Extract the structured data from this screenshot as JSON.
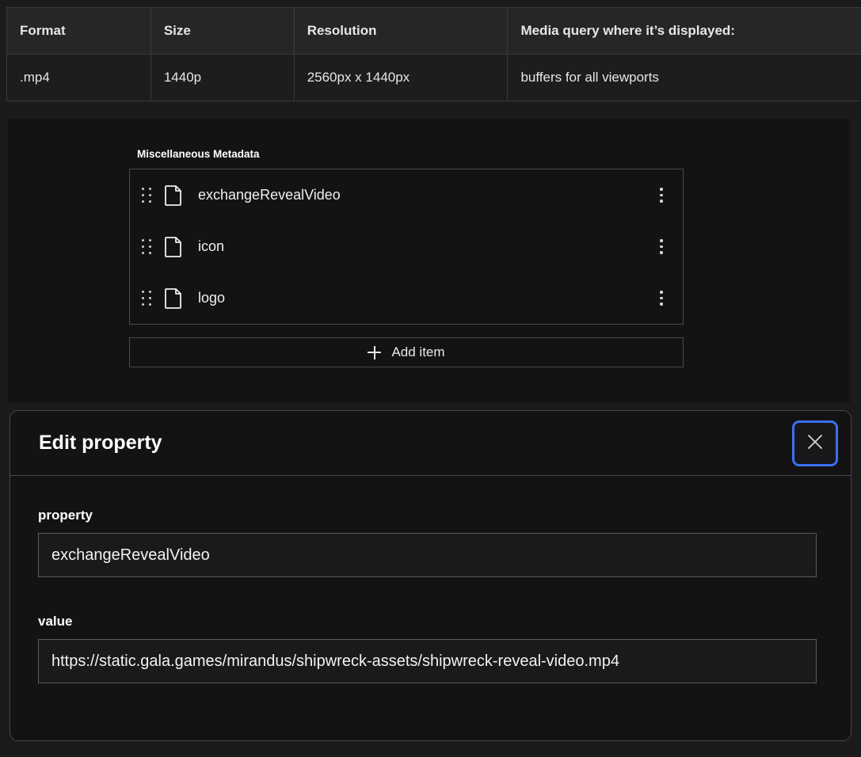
{
  "specs_table": {
    "columns": [
      "Format",
      "Size",
      "Resolution",
      "Media query where it’s displayed:"
    ],
    "rows": [
      [
        ".mp4",
        "1440p",
        "2560px x 1440px",
        "buffers for all viewports"
      ]
    ]
  },
  "metadata_panel": {
    "section_label": "Miscellaneous Metadata",
    "items": [
      {
        "label": "exchangeRevealVideo"
      },
      {
        "label": "icon"
      },
      {
        "label": "logo"
      }
    ],
    "add_item_label": "Add item",
    "icons": {
      "drag": "drag-handle-icon",
      "file": "file-document-icon",
      "menu": "kebab-menu-icon",
      "add": "plus-icon"
    }
  },
  "dialog": {
    "title": "Edit property",
    "close_label": "×",
    "close_icon": "close-x-icon",
    "focus_ring_color": "#3b6ff5",
    "fields": [
      {
        "label": "property",
        "value": "exchangeRevealVideo",
        "placeholder": ""
      },
      {
        "label": "value",
        "value": "https://static.gala.games/mirandus/shipwreck-assets/shipwreck-reveal-video.mp4",
        "placeholder": ""
      }
    ]
  },
  "colors": {
    "page_background": "#1b1b1b",
    "panel_background": "#131314",
    "table_header_background": "#262626",
    "border": "#45454d",
    "accent_blue": "#3b6ff5",
    "text_primary": "#ffffff"
  }
}
